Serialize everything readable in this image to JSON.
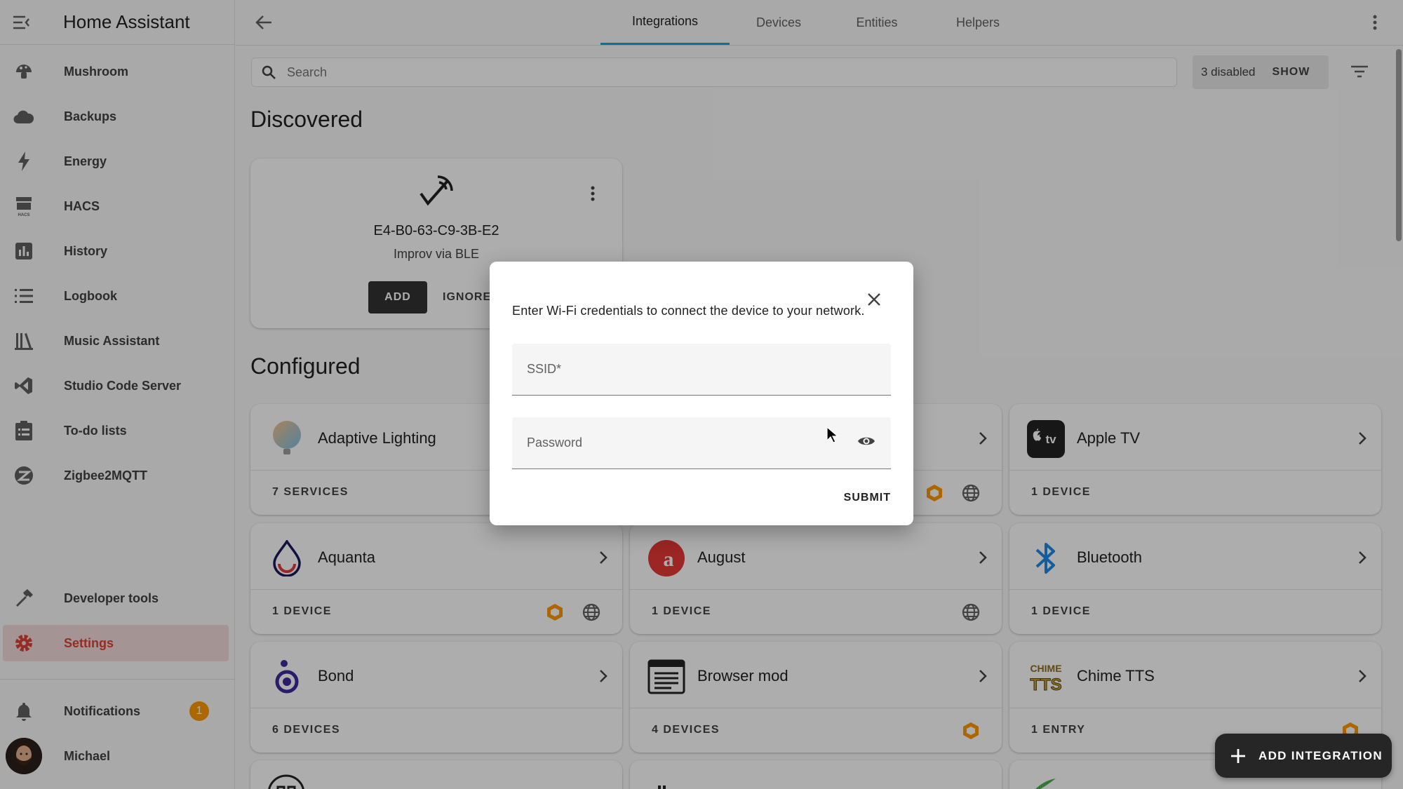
{
  "app": {
    "title": "Home Assistant"
  },
  "sidebar": {
    "items": [
      {
        "label": "Mushroom",
        "icon": "mushroom-icon"
      },
      {
        "label": "Backups",
        "icon": "cloud-icon"
      },
      {
        "label": "Energy",
        "icon": "lightning-icon"
      },
      {
        "label": "HACS",
        "icon": "hacs-icon"
      },
      {
        "label": "History",
        "icon": "chart-bar-icon"
      },
      {
        "label": "Logbook",
        "icon": "list-icon"
      },
      {
        "label": "Music Assistant",
        "icon": "music-library-icon"
      },
      {
        "label": "Studio Code Server",
        "icon": "vscode-icon"
      },
      {
        "label": "To-do lists",
        "icon": "clipboard-list-icon"
      },
      {
        "label": "Zigbee2MQTT",
        "icon": "zigbee-icon"
      }
    ],
    "developer_tools": "Developer tools",
    "settings": "Settings",
    "notifications": "Notifications",
    "notifications_count": "1",
    "user": "Michael"
  },
  "tabs": [
    "Integrations",
    "Devices",
    "Entities",
    "Helpers"
  ],
  "search": {
    "placeholder": "Search"
  },
  "filter": {
    "disabled_text": "3 disabled",
    "show_label": "SHOW"
  },
  "discovered": {
    "heading": "Discovered",
    "device_id": "E4-B0-63-C9-3B-E2",
    "source": "Improv via BLE",
    "add_label": "ADD",
    "ignore_label": "IGNORE"
  },
  "configured": {
    "heading": "Configured",
    "cards": [
      {
        "name": "Adaptive Lighting",
        "count": "7 SERVICES"
      },
      {
        "name": "",
        "count": ""
      },
      {
        "name": "Apple TV",
        "count": "1 DEVICE"
      },
      {
        "name": "Aquanta",
        "count": "1 DEVICE"
      },
      {
        "name": "August",
        "count": "1 DEVICE"
      },
      {
        "name": "Bluetooth",
        "count": "1 DEVICE"
      },
      {
        "name": "Bond",
        "count": "6 DEVICES"
      },
      {
        "name": "Browser mod",
        "count": "4 DEVICES"
      },
      {
        "name": "Chime TTS",
        "count": "1 ENTRY"
      }
    ]
  },
  "dialog": {
    "message": "Enter Wi-Fi credentials to connect the device to your network.",
    "ssid_label": "SSID*",
    "password_label": "Password",
    "submit_label": "SUBMIT"
  },
  "fab": {
    "label": "ADD INTEGRATION"
  },
  "colors": {
    "accent": "#03a9f4",
    "settings_active": "#db4437",
    "badge": "#ff9800",
    "custom_integration": "#ff9800"
  }
}
